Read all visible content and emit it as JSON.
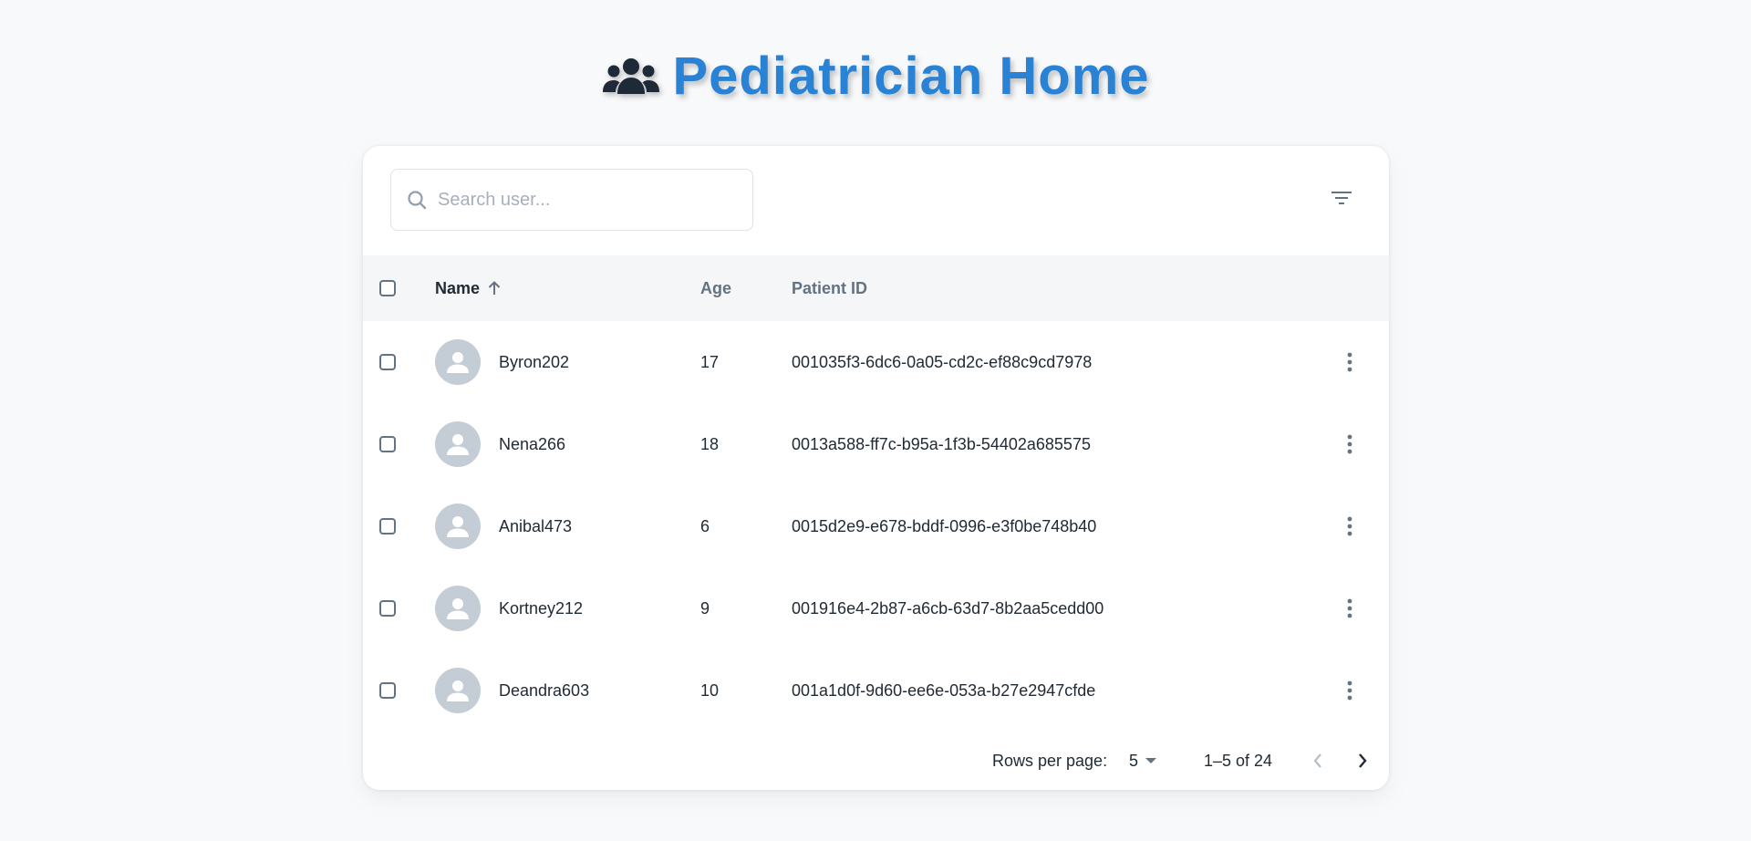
{
  "header": {
    "title": "Pediatrician Home",
    "icon": "users-group-icon"
  },
  "search": {
    "placeholder": "Search user...",
    "value": ""
  },
  "table": {
    "columns": [
      {
        "key": "name",
        "label": "Name",
        "sorted": "asc"
      },
      {
        "key": "age",
        "label": "Age"
      },
      {
        "key": "patient_id",
        "label": "Patient ID"
      }
    ],
    "rows": [
      {
        "name": "Byron202",
        "age": "17",
        "patient_id": "001035f3-6dc6-0a05-cd2c-ef88c9cd7978"
      },
      {
        "name": "Nena266",
        "age": "18",
        "patient_id": "0013a588-ff7c-b95a-1f3b-54402a685575"
      },
      {
        "name": "Anibal473",
        "age": "6",
        "patient_id": "0015d2e9-e678-bddf-0996-e3f0be748b40"
      },
      {
        "name": "Kortney212",
        "age": "9",
        "patient_id": "001916e4-2b87-a6cb-63d7-8b2aa5cedd00"
      },
      {
        "name": "Deandra603",
        "age": "10",
        "patient_id": "001a1d0f-9d60-ee6e-053a-b27e2947cfde"
      }
    ]
  },
  "pagination": {
    "rows_per_page_label": "Rows per page:",
    "rows_per_page_value": "5",
    "range_label": "1–5 of 24"
  },
  "colors": {
    "title": "#2a82d4",
    "background": "#f8f9fa",
    "header_row": "#f4f6f8",
    "avatar": "#c4cdd5"
  }
}
